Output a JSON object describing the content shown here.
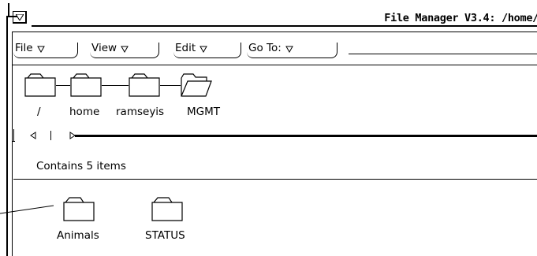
{
  "window": {
    "title": "File Manager V3.4: /home/"
  },
  "menu_bar": {
    "items": [
      {
        "label": "File"
      },
      {
        "label": "View"
      },
      {
        "label": "Edit"
      },
      {
        "label": "Go To:"
      }
    ]
  },
  "path_pane": {
    "folders": [
      {
        "label": "/",
        "state": "closed"
      },
      {
        "label": "home",
        "state": "closed"
      },
      {
        "label": "ramseyis",
        "state": "closed"
      },
      {
        "label": "MGMT",
        "state": "open"
      }
    ]
  },
  "status": {
    "text": "Contains 5 items"
  },
  "files": {
    "items": [
      {
        "label": "Animals",
        "icon": "folder-icon"
      },
      {
        "label": "STATUS",
        "icon": "folder-icon"
      }
    ]
  }
}
